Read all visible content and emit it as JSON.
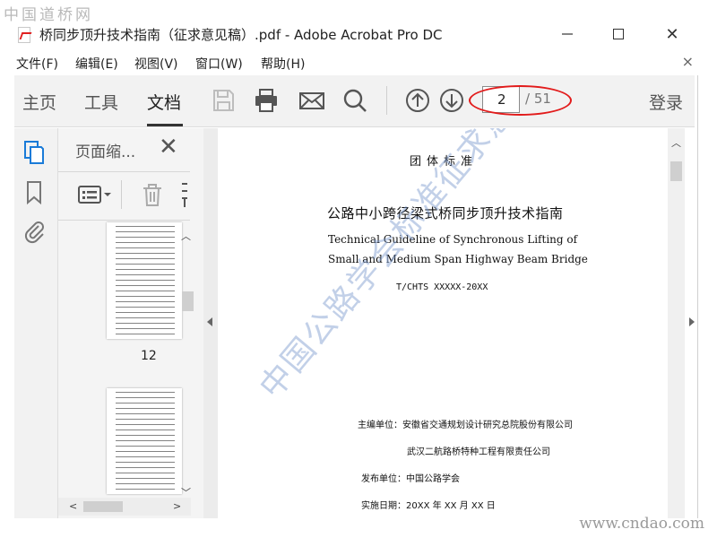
{
  "watermarks": {
    "top_left": "中国道桥网",
    "bottom_right": "www.cndao.com",
    "document_overlay": "中国公路学会标准征求意见稿"
  },
  "window": {
    "title": "桥同步顶升技术指南（征求意见稿）.pdf - Adobe Acrobat Pro DC",
    "minimize_icon": "minimize-icon",
    "maximize_icon": "maximize-icon",
    "close_symbol": "✕"
  },
  "menu": {
    "items": [
      "文件(F)",
      "编辑(E)",
      "视图(V)",
      "窗口(W)",
      "帮助(H)"
    ],
    "close_symbol": "×"
  },
  "toolbar": {
    "tabs": [
      "主页",
      "工具",
      "文档"
    ],
    "active_tab": "文档",
    "icons": [
      "save-icon",
      "print-icon",
      "mail-icon",
      "search-icon",
      "page-up-icon",
      "page-down-icon"
    ],
    "page_current": "2",
    "page_total": "/ 51",
    "login_label": "登录",
    "highlight_color": "#e21b1b"
  },
  "left_rail": {
    "icons": [
      "page-thumbnails-icon",
      "bookmark-icon",
      "attachment-icon"
    ]
  },
  "thumbnails": {
    "title": "页面缩...",
    "close_symbol": "✕",
    "tools": [
      "options-menu-icon",
      "trash-icon"
    ],
    "pages": [
      {
        "label": "12"
      },
      {
        "label": ""
      }
    ]
  },
  "document": {
    "heading": "团体标准",
    "title_cn": "公路中小跨径梁式桥同步顶升技术指南",
    "title_en_line1": "Technical Guideline of Synchronous Lifting of",
    "title_en_line2": "Small and Medium Span Highway Beam Bridge",
    "code": "T/CHTS XXXXX-20XX",
    "editor_unit": "主编单位：安徽省交通规划设计研究总院股份有限公司",
    "co_unit": "武汉二航路桥特种工程有限责任公司",
    "publisher": "发布单位：中国公路学会",
    "effective_date": "实施日期：20XX 年 XX 月 XX 日"
  }
}
